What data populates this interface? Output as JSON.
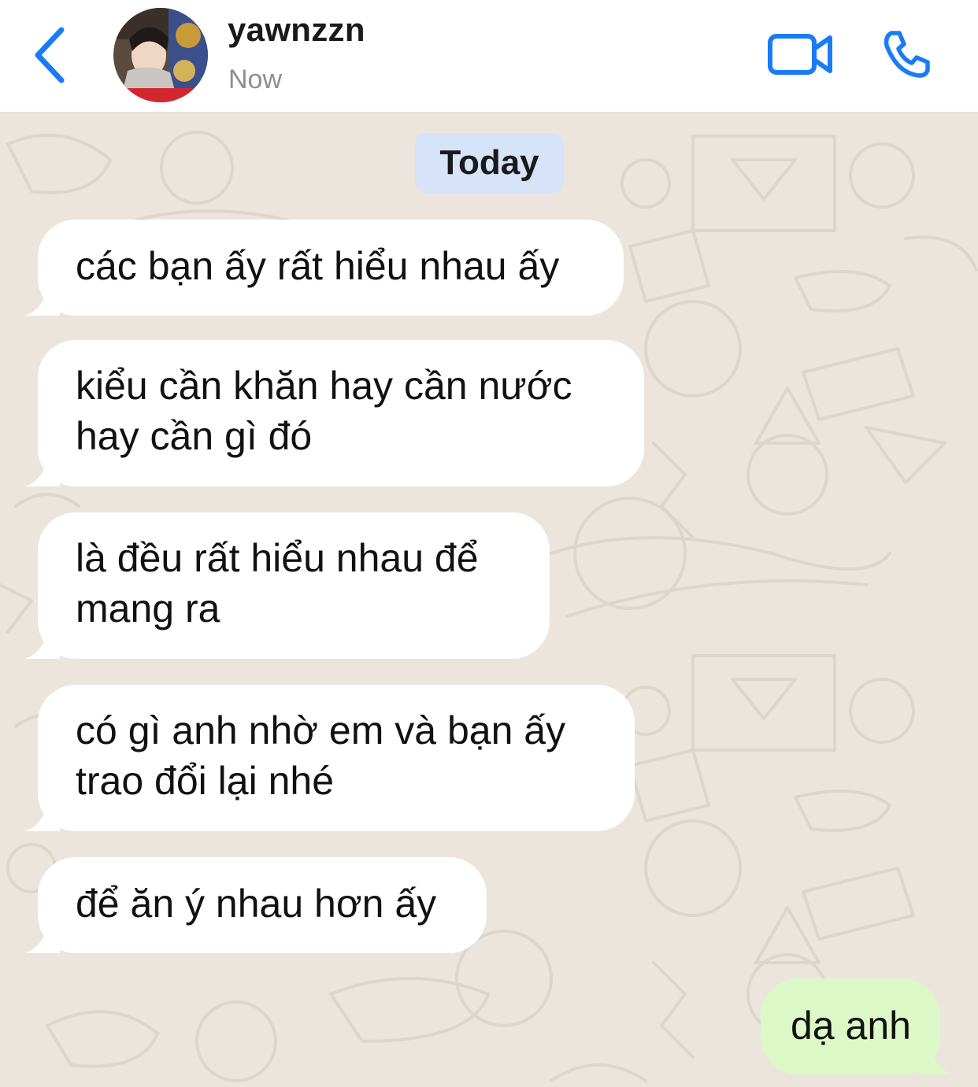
{
  "header": {
    "back_icon": "chevron-left-icon",
    "contact_name": "yawnzzn",
    "status": "Now",
    "video_icon": "video-camera-icon",
    "phone_icon": "phone-icon"
  },
  "chat": {
    "date_label": "Today",
    "messages": [
      {
        "direction": "incoming",
        "text": "các bạn ấy rất hiểu nhau ấy"
      },
      {
        "direction": "incoming",
        "text": "kiểu cần khăn hay cần nước\nhay cần gì đó"
      },
      {
        "direction": "incoming",
        "text": "là đều rất hiểu nhau để\nmang ra"
      },
      {
        "direction": "incoming",
        "text": "có gì anh nhờ em và bạn ấy\ntrao đổi lại nhé"
      },
      {
        "direction": "incoming",
        "text": "để ăn ý nhau hơn ấy"
      },
      {
        "direction": "outgoing",
        "text": "dạ anh"
      }
    ]
  },
  "colors": {
    "accent": "#1a7cf5",
    "chat_background": "#ece5dd",
    "incoming_bubble": "#ffffff",
    "outgoing_bubble": "#dcf8c6",
    "date_chip": "#d6e3f9"
  }
}
